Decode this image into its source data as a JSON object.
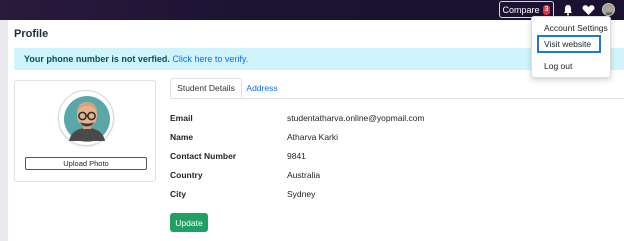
{
  "topbar": {
    "compare_label": "Compare",
    "compare_count": "3"
  },
  "page": {
    "title": "Profile"
  },
  "alert": {
    "message": "Your phone number is not verfied.",
    "link": "Click here to verify."
  },
  "photo": {
    "upload_label": "Upload Photo"
  },
  "tabs": [
    {
      "label": "Student Details",
      "active": true
    },
    {
      "label": "Address",
      "active": false
    }
  ],
  "details": [
    {
      "label": "Email",
      "value": "studentatharva.online@yopmail.com"
    },
    {
      "label": "Name",
      "value": "Atharva Karki"
    },
    {
      "label": "Contact Number",
      "value": "9841"
    },
    {
      "label": "Country",
      "value": "Australia"
    },
    {
      "label": "City",
      "value": "Sydney"
    }
  ],
  "update_label": "Update",
  "dropdown": {
    "items": [
      "Account Settings",
      "Visit website",
      "Log out"
    ]
  },
  "colors": {
    "topbar": "#1c1333",
    "alert_bg": "#cff4fc",
    "update_button": "#20a163",
    "highlight": "#1f78d1"
  }
}
